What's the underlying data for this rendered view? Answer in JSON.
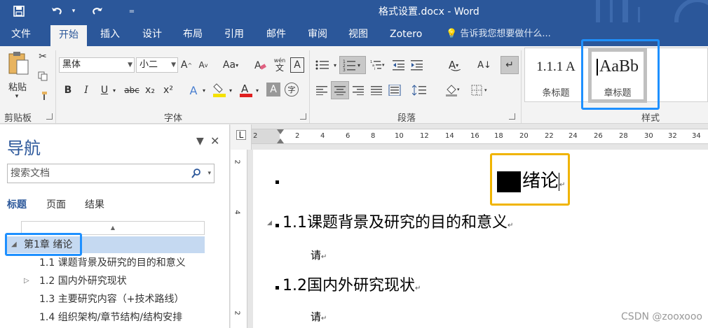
{
  "titlebar": {
    "title": "格式设置.docx - Word",
    "save_icon": "save-icon",
    "undo_icon": "undo-icon",
    "redo_icon": "redo-icon",
    "customize_icon": "customize-qat-icon"
  },
  "tabs": [
    {
      "label": "文件"
    },
    {
      "label": "开始"
    },
    {
      "label": "插入"
    },
    {
      "label": "设计"
    },
    {
      "label": "布局"
    },
    {
      "label": "引用"
    },
    {
      "label": "邮件"
    },
    {
      "label": "审阅"
    },
    {
      "label": "视图"
    },
    {
      "label": "Zotero"
    }
  ],
  "tell_me": "告诉我您想要做什么...",
  "ribbon": {
    "clipboard": {
      "paste_label": "粘贴",
      "group_label": "剪贴板"
    },
    "font": {
      "font_name": "黑体",
      "font_size": "小二",
      "group_label": "字体",
      "bold": "B",
      "italic": "I",
      "underline": "U",
      "strike": "abc",
      "subscript": "x₂",
      "superscript": "x²",
      "phonetic": "wén",
      "case_label": "Aa"
    },
    "paragraph": {
      "group_label": "段落"
    },
    "styles": {
      "group_label": "样式",
      "items": [
        {
          "preview": "1.1.1  A",
          "name": "条标题"
        },
        {
          "preview": "AaBb",
          "name": "章标题"
        }
      ]
    }
  },
  "nav": {
    "title": "导航",
    "search_placeholder": "搜索文档",
    "tabs": [
      "标题",
      "页面",
      "结果"
    ],
    "tree": [
      {
        "label": "第1章 绪论",
        "level": 0,
        "selected": true
      },
      {
        "label": "1.1 课题背景及研究的目的和意义",
        "level": 1
      },
      {
        "label": "1.2 国内外研究现状",
        "level": 1
      },
      {
        "label": "1.3 主要研究内容（+技术路线）",
        "level": 1
      },
      {
        "label": "1.4 组织架构/章节结构/结构安排",
        "level": 1
      }
    ]
  },
  "ruler": {
    "h_ticks": [
      "2",
      "2",
      "4",
      "6",
      "8",
      "10",
      "12",
      "14",
      "16",
      "18",
      "20",
      "22",
      "24",
      "26",
      "28",
      "30",
      "32",
      "34"
    ],
    "v_ticks": [
      "2",
      "4",
      "2"
    ]
  },
  "document": {
    "chapter_title": "绪论",
    "sections": [
      {
        "number": "1.1",
        "title": "课题背景及研究的目的和意义",
        "body": "请"
      },
      {
        "number": "1.2",
        "title": "国内外研究现状",
        "body": "请"
      }
    ],
    "pilcrow": "↵"
  },
  "watermark": "CSDN @zooxooo"
}
